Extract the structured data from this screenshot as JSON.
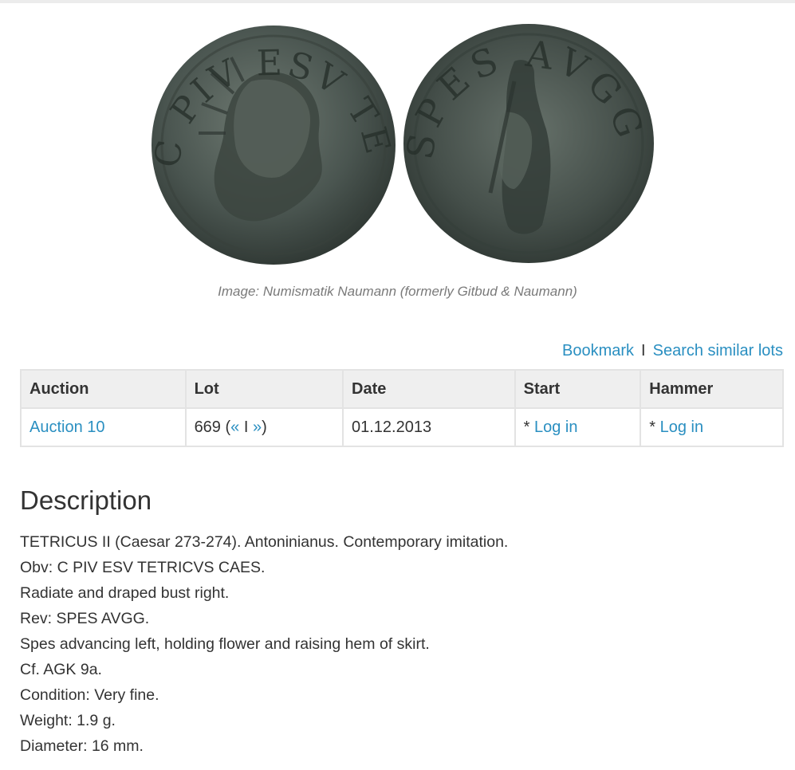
{
  "image": {
    "caption": "Image: Numismatik Naumann (formerly Gitbud & Naumann)",
    "obverse_legend": "C PIV ESV TETRICVS CAES",
    "reverse_legend": "SPES AVGG"
  },
  "actions": {
    "bookmark": "Bookmark",
    "separator": "I",
    "search_similar": "Search similar lots"
  },
  "table": {
    "headers": {
      "auction": "Auction",
      "lot": "Lot",
      "date": "Date",
      "start": "Start",
      "hammer": "Hammer"
    },
    "row": {
      "auction": "Auction 10",
      "lot_number": "669 (",
      "prev": "«",
      "lot_sep": " I ",
      "next": "»",
      "lot_close": ")",
      "date": "01.12.2013",
      "start_prefix": "* ",
      "start_link": "Log in",
      "hammer_prefix": "* ",
      "hammer_link": "Log in"
    }
  },
  "description": {
    "heading": "Description",
    "lines": [
      "TETRICUS II (Caesar 273-274). Antoninianus. Contemporary imitation.",
      "Obv: C PIV ESV TETRICVS CAES.",
      "Radiate and draped bust right.",
      "Rev: SPES AVGG.",
      "Spes advancing left, holding flower and raising hem of skirt.",
      "Cf. AGK 9a.",
      "Condition: Very fine.",
      "Weight: 1.9 g.",
      "Diameter: 16 mm."
    ]
  },
  "colors": {
    "link": "#2a8fc1",
    "text": "#333333",
    "header_bg": "#efefef",
    "border": "#e3e3e3",
    "coin": "#4a5550"
  }
}
